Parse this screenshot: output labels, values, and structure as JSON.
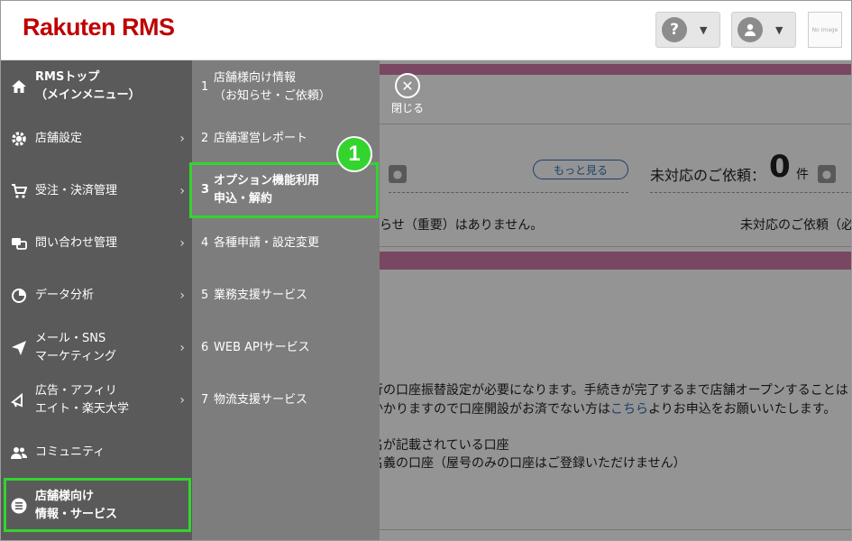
{
  "header": {
    "logo": "Rakuten RMS",
    "help_symbol": "?",
    "no_image": "No Image"
  },
  "background": {
    "more_button": "もっと見る",
    "pending_label": "未対応のご依頼：",
    "pending_count": "0",
    "pending_unit": "件",
    "notice_text": "らせ（重要）はありません。",
    "pending_text": "未対応のご依頼（必",
    "body_line1": "行の口座振替設定が必要になります。手続きが完了するまで店舗オープンすることは",
    "body_line2a": "かかりますので口座開設がお済でない方は",
    "body_link": "こちら",
    "body_line2b": "よりお申込をお願いいたします。",
    "body_line3": "名が記載されている口座",
    "body_line4": "名義の口座（屋号のみの口座はご登録いただけません）"
  },
  "close": {
    "label": "閉じる"
  },
  "sidebar": {
    "items": [
      {
        "line1": "RMSトップ",
        "line2": "（メインメニュー）",
        "icon": "home-icon",
        "arrow": ""
      },
      {
        "line1": "店舗設定",
        "line2": "",
        "icon": "gear-icon",
        "arrow": "›"
      },
      {
        "line1": "受注・決済管理",
        "line2": "",
        "icon": "cart-icon",
        "arrow": "›"
      },
      {
        "line1": "問い合わせ管理",
        "line2": "",
        "icon": "chat-icon",
        "arrow": "›"
      },
      {
        "line1": "データ分析",
        "line2": "",
        "icon": "pie-chart-icon",
        "arrow": "›"
      },
      {
        "line1": "メール・SNS",
        "line2": "マーケティング",
        "icon": "send-icon",
        "arrow": "›"
      },
      {
        "line1": "広告・アフィリ",
        "line2": "エイト・楽天大学",
        "icon": "megaphone-icon",
        "arrow": "›"
      },
      {
        "line1": "コミュニティ",
        "line2": "",
        "icon": "people-icon",
        "arrow": ""
      },
      {
        "line1": "店舗様向け",
        "line2": "情報・サービス",
        "icon": "list-icon",
        "arrow": ""
      }
    ]
  },
  "submenu": {
    "items": [
      {
        "num": "1",
        "line1": "店舗様向け情報",
        "line2": "（お知らせ・ご依頼）"
      },
      {
        "num": "2",
        "line1": "店舗運営レポート",
        "line2": ""
      },
      {
        "num": "3",
        "line1": "オプション機能利用",
        "line2": "申込・解約"
      },
      {
        "num": "4",
        "line1": "各種申請・設定変更",
        "line2": ""
      },
      {
        "num": "5",
        "line1": "業務支援サービス",
        "line2": ""
      },
      {
        "num": "6",
        "line1": "WEB APIサービス",
        "line2": ""
      },
      {
        "num": "7",
        "line1": "物流支援サービス",
        "line2": ""
      }
    ]
  },
  "annotation": {
    "badge": "1"
  },
  "colors": {
    "highlight": "#33d42e",
    "brand": "#bf0000",
    "accent_bar": "#d07aa7"
  }
}
